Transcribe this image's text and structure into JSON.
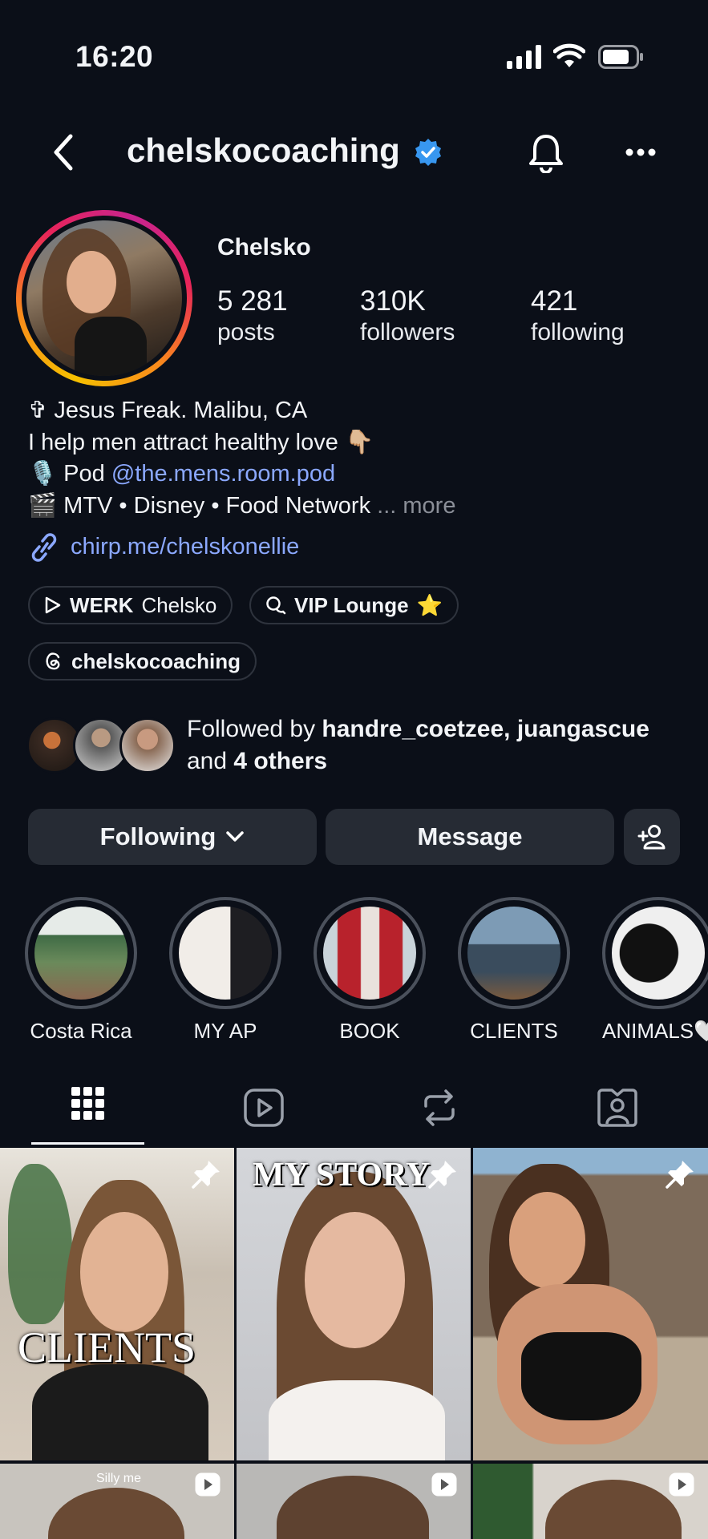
{
  "status_bar": {
    "time": "16:20"
  },
  "header": {
    "username": "chelskocoaching"
  },
  "profile": {
    "display_name": "Chelsko",
    "stats": [
      {
        "value": "5 281",
        "label": "posts"
      },
      {
        "value": "310K",
        "label": "followers"
      },
      {
        "value": "421",
        "label": "following"
      }
    ],
    "bio": {
      "line1": "✞ Jesus Freak. Malibu, CA",
      "line2": "I help men attract healthy love 👇🏼",
      "line3_prefix": "🎙️ Pod ",
      "line3_mention": "@the.mens.room.pod",
      "line4": "🎬 MTV • Disney • Food Network",
      "line4_ellipsis": "...",
      "more": "more"
    },
    "link": "chirp.me/chelskonellie"
  },
  "pills": [
    {
      "bold": "WERK",
      "text": "Chelsko"
    },
    {
      "bold": "VIP Lounge",
      "text": "⭐"
    },
    {
      "bold": "chelskocoaching",
      "text": ""
    }
  ],
  "followed_by": {
    "prefix": "Followed by ",
    "names": "handre_coetzee, juangascue",
    "middle": "and ",
    "others": "4 others"
  },
  "actions": {
    "following": "Following",
    "message": "Message"
  },
  "highlights": [
    {
      "label": "Costa Rica"
    },
    {
      "label": "MY AP"
    },
    {
      "label": "BOOK"
    },
    {
      "label": "CLIENTS"
    },
    {
      "label": "ANIMALS🤍"
    }
  ],
  "grid": {
    "post1_text": "CLIENTS",
    "post2_text": "MY STORY",
    "post4_text": "Silly me"
  },
  "colors": {
    "background": "#0b0f18",
    "link": "#8ba8ff",
    "verified": "#3897f0",
    "button": "#262b34"
  }
}
